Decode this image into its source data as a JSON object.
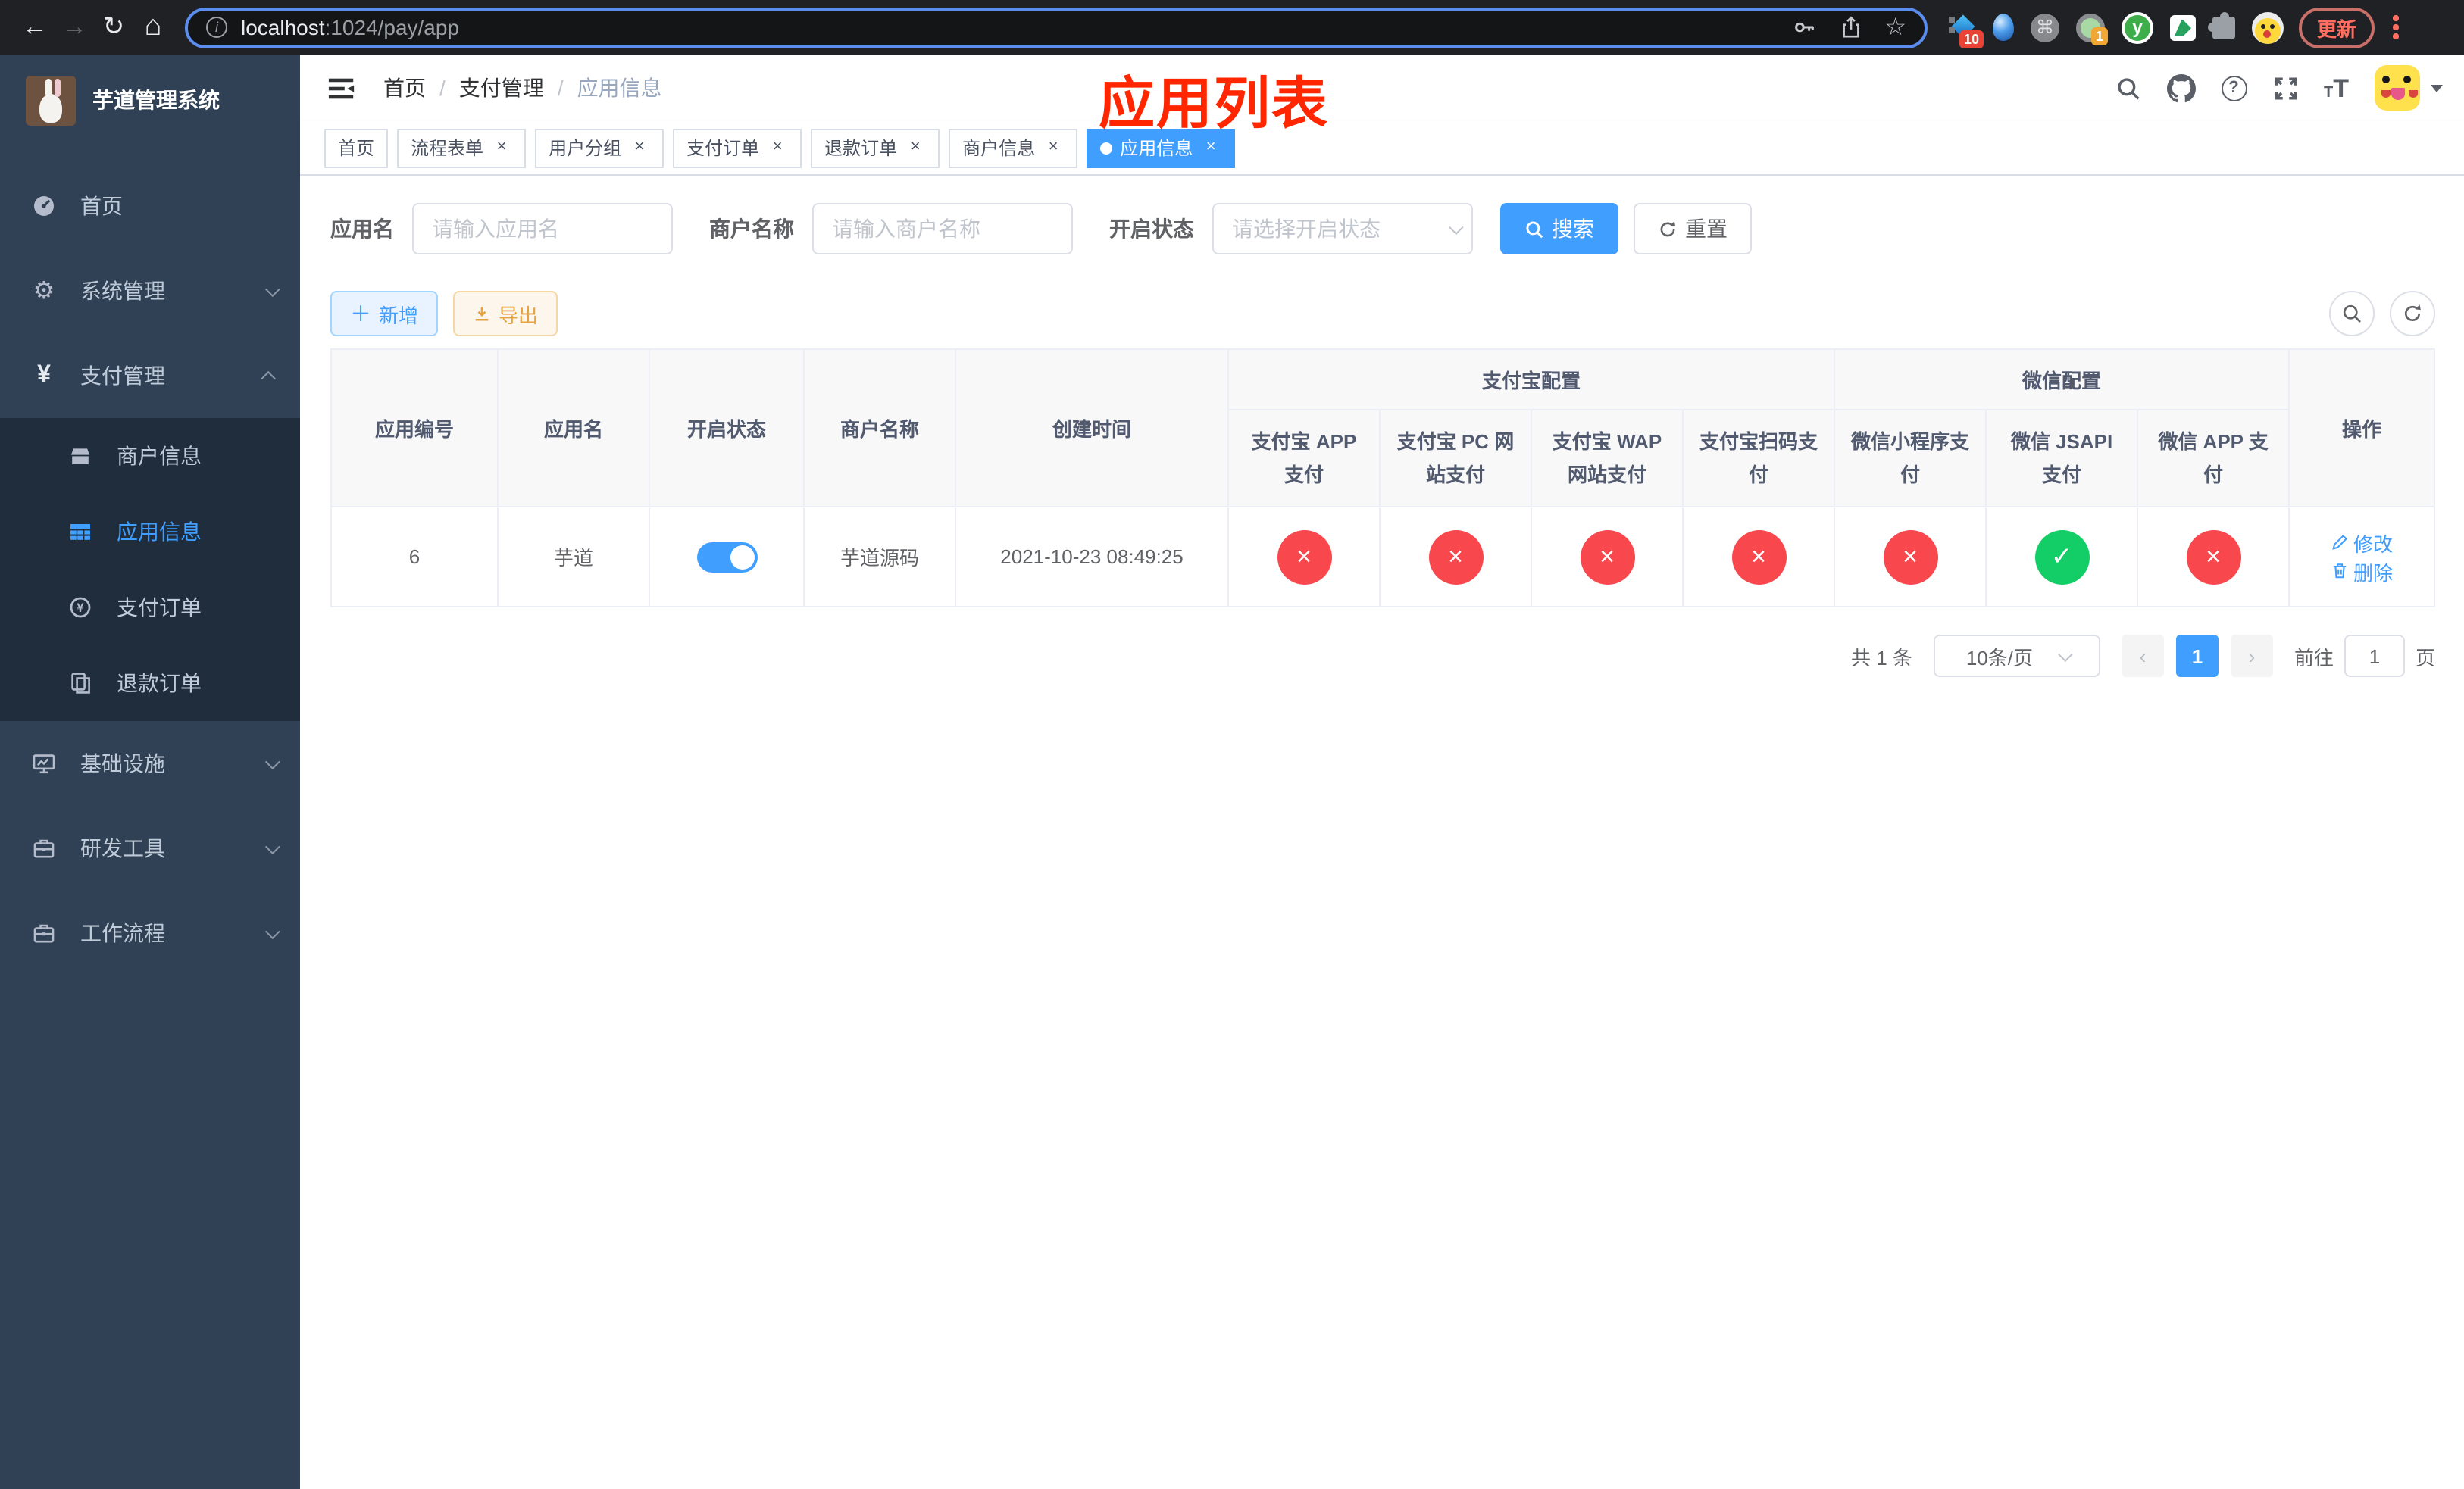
{
  "browser": {
    "url_host": "localhost",
    "url_path": ":1024/pay/app",
    "update_label": "更新",
    "ext_badge_diamond": "10",
    "ext_badge_target": "1",
    "ext_y_letter": "y"
  },
  "sidebar": {
    "title": "芋道管理系统",
    "menu": [
      {
        "key": "home",
        "label": "首页",
        "icon": "dashboard-icon",
        "arrow": "none"
      },
      {
        "key": "system",
        "label": "系统管理",
        "icon": "gear-icon",
        "arrow": "down"
      },
      {
        "key": "payment",
        "label": "支付管理",
        "icon": "yuan-icon",
        "arrow": "up",
        "open": true,
        "children": [
          {
            "key": "merchant-info",
            "label": "商户信息",
            "icon": "shop-icon"
          },
          {
            "key": "app-info",
            "label": "应用信息",
            "icon": "grid-icon",
            "active": true
          },
          {
            "key": "pay-order",
            "label": "支付订单",
            "icon": "pay-order-icon"
          },
          {
            "key": "refund-order",
            "label": "退款订单",
            "icon": "refund-icon"
          }
        ]
      },
      {
        "key": "infrastructure",
        "label": "基础设施",
        "icon": "monitor-icon",
        "arrow": "down"
      },
      {
        "key": "dev-tools",
        "label": "研发工具",
        "icon": "toolbox-icon",
        "arrow": "down"
      },
      {
        "key": "workflow",
        "label": "工作流程",
        "icon": "workflow-icon",
        "arrow": "down"
      }
    ]
  },
  "breadcrumb": {
    "items": [
      "首页",
      "支付管理",
      "应用信息"
    ]
  },
  "annotation": "应用列表",
  "tabs": [
    {
      "key": "home",
      "label": "首页",
      "closable": false,
      "active": false
    },
    {
      "key": "process-form",
      "label": "流程表单",
      "closable": true,
      "active": false
    },
    {
      "key": "user-group",
      "label": "用户分组",
      "closable": true,
      "active": false
    },
    {
      "key": "pay-order",
      "label": "支付订单",
      "closable": true,
      "active": false
    },
    {
      "key": "refund-order",
      "label": "退款订单",
      "closable": true,
      "active": false
    },
    {
      "key": "merchant-info",
      "label": "商户信息",
      "closable": true,
      "active": false
    },
    {
      "key": "app-info",
      "label": "应用信息",
      "closable": true,
      "active": true
    }
  ],
  "filters": {
    "app_name_label": "应用名",
    "app_name_placeholder": "请输入应用名",
    "merchant_name_label": "商户名称",
    "merchant_name_placeholder": "请输入商户名称",
    "status_label": "开启状态",
    "status_placeholder": "请选择开启状态",
    "search_label": "搜索",
    "reset_label": "重置"
  },
  "toolbar": {
    "add_label": "新增",
    "export_label": "导出"
  },
  "table": {
    "group_headers": {
      "alipay": "支付宝配置",
      "wechat": "微信配置"
    },
    "columns": {
      "app_id": "应用编号",
      "app_name": "应用名",
      "status": "开启状态",
      "merchant_name": "商户名称",
      "create_time": "创建时间",
      "alipay_app": "支付宝 APP 支付",
      "alipay_pc": "支付宝 PC 网站支付",
      "alipay_wap": "支付宝 WAP 网站支付",
      "alipay_qr": "支付宝扫码支付",
      "wx_lite": "微信小程序支付",
      "wx_jsapi": "微信 JSAPI 支付",
      "wx_app": "微信 APP 支付",
      "actions": "操作"
    },
    "row": {
      "app_id": "6",
      "app_name": "芋道",
      "enabled": true,
      "merchant_name": "芋道源码",
      "create_time": "2021-10-23 08:49:25",
      "configs": [
        false,
        false,
        false,
        false,
        false,
        true,
        false
      ],
      "edit_label": "修改",
      "delete_label": "删除"
    }
  },
  "pagination": {
    "total": "共 1 条",
    "page_size": "10条/页",
    "prev_label": "‹",
    "next_label": "›",
    "current_page": "1",
    "goto_label": "前往",
    "goto_value": "1",
    "goto_suffix": "页"
  },
  "colors": {
    "primary": "#409eff",
    "success": "#13ce66",
    "danger": "#f8484e",
    "annotation": "#ff2600"
  }
}
